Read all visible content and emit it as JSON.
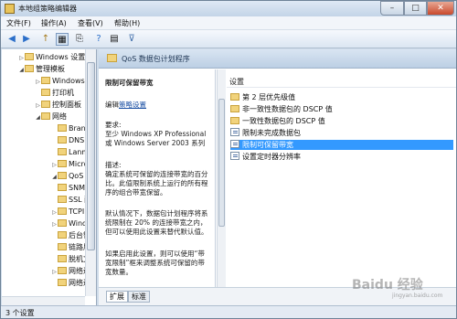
{
  "window": {
    "title": "本地组策略编辑器",
    "minimize": "–",
    "maximize": "□",
    "close": "✕"
  },
  "menu": [
    "文件(F)",
    "操作(A)",
    "查看(V)",
    "帮助(H)"
  ],
  "toolbar": {
    "back": "◀",
    "forward": "▶",
    "up": "↑",
    "show": "▦",
    "export": "⎘",
    "help": "?",
    "props": "▤",
    "filter": "⊽"
  },
  "tree": [
    {
      "label": "Windows 设置",
      "expander": "▷"
    },
    {
      "label": "管理模板",
      "expander": "◢"
    },
    {
      "label": "Windows",
      "expander": "▷"
    },
    {
      "label": "打印机",
      "expander": ""
    },
    {
      "label": "控制面板",
      "expander": "▷"
    },
    {
      "label": "网络",
      "expander": "◢"
    },
    {
      "label": "BranchC",
      "expander": ""
    },
    {
      "label": "DNS 客",
      "expander": ""
    },
    {
      "label": "Lanma",
      "expander": ""
    },
    {
      "label": "Micro",
      "expander": "▷"
    },
    {
      "label": "QoS 数",
      "expander": "◢"
    },
    {
      "label": "SNMP",
      "expander": ""
    },
    {
      "label": "SSL 配",
      "expander": ""
    },
    {
      "label": "TCPIP",
      "expander": "▷"
    },
    {
      "label": "Windo",
      "expander": "▷"
    },
    {
      "label": "后台智",
      "expander": ""
    },
    {
      "label": "链路层",
      "expander": ""
    },
    {
      "label": "脱机文",
      "expander": ""
    },
    {
      "label": "网络连",
      "expander": "▷"
    },
    {
      "label": "网络连",
      "expander": ""
    }
  ],
  "header": {
    "title": "QoS 数据包计划程序"
  },
  "description": {
    "title": "限制可保留带宽",
    "edit_prefix": "编辑",
    "edit_link": "策略设置",
    "lines": [
      "要求:",
      "至少 Windows XP Professional",
      "或 Windows Server 2003 系列",
      "",
      "描述:",
      "确定系统可保留的连接带宽的百分",
      "比。此值限制系统上运行的所有程",
      "序的组合带宽保留。",
      "",
      "默认情况下，数据包计划程序将系",
      "统限制在 20% 的连接带宽之内，",
      "但可以使用此设置来替代默认值。",
      "",
      "如果启用此设置，则可以使用“带",
      "宽限制”框来调整系统可保留的带",
      "宽数量。"
    ]
  },
  "list": {
    "column": "设置",
    "rows": [
      {
        "label": "第 2 层优先级值",
        "kind": "folder",
        "selected": false
      },
      {
        "label": "非一致性数据包的 DSCP 值",
        "kind": "folder",
        "selected": false
      },
      {
        "label": "一致性数据包的 DSCP 值",
        "kind": "folder",
        "selected": false
      },
      {
        "label": "限制未完成数据包",
        "kind": "policy",
        "selected": false
      },
      {
        "label": "限制可保留带宽",
        "kind": "policy",
        "selected": true
      },
      {
        "label": "设置定时器分辨率",
        "kind": "policy",
        "selected": false
      }
    ]
  },
  "tabs": [
    "扩展",
    "标准"
  ],
  "status": "3 个设置",
  "watermark": {
    "main": "Baidu 经验",
    "sub": "jingyan.baidu.com"
  },
  "colors": {
    "selection": "#3399ff",
    "link": "#1a4fa3"
  }
}
